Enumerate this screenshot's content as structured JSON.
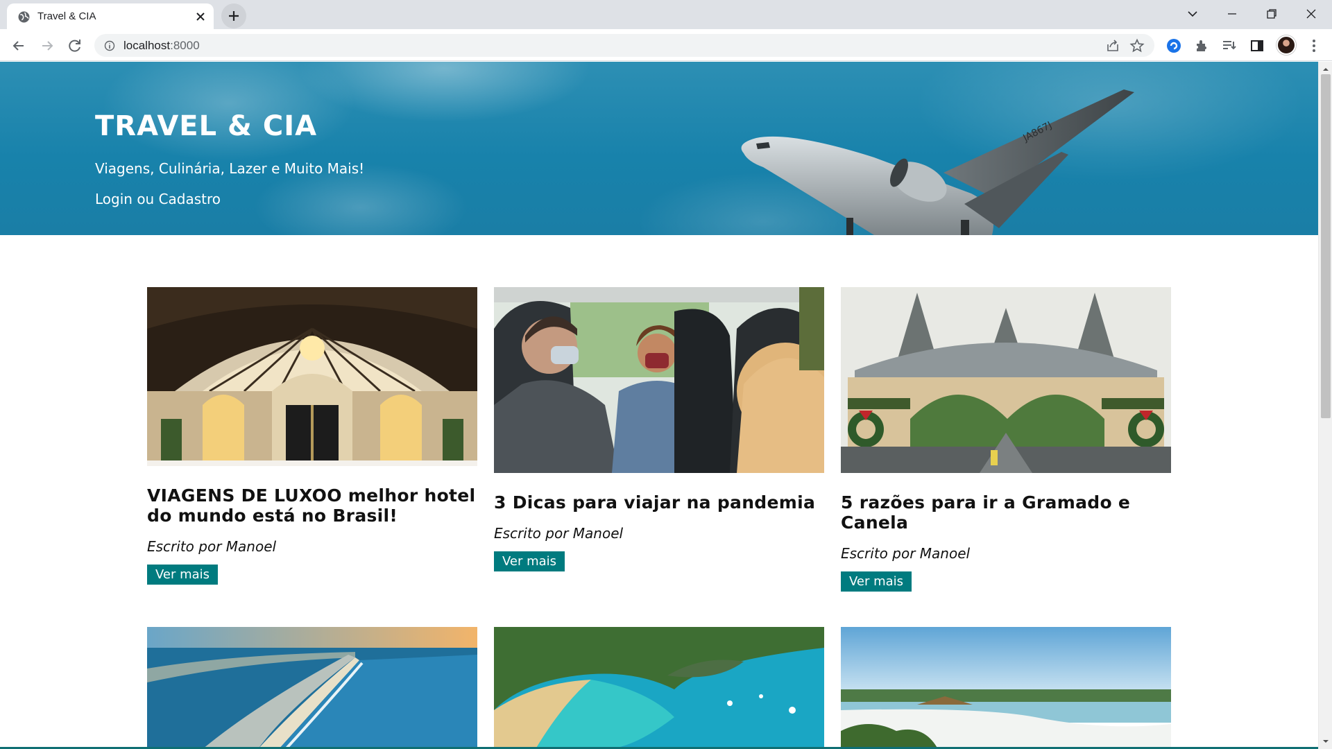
{
  "browser": {
    "tab_title": "Travel & CIA",
    "url_host": "localhost",
    "url_port": ":8000"
  },
  "hero": {
    "title": "TRAVEL & CIA",
    "subtitle": "Viagens, Culinária, Lazer e Muito Mais!",
    "login_link": "Login ou Cadastro",
    "plane_registration": "JA867J"
  },
  "posts": [
    {
      "title": "VIAGENS DE LUXOO melhor hotel do mundo está no Brasil!",
      "author": "Escrito por Manoel",
      "button": "Ver mais",
      "image": "luxury-hotel-entrance"
    },
    {
      "title": "3 Dicas para viajar na pandemia",
      "author": "Escrito por Manoel",
      "button": "Ver mais",
      "image": "masked-travelers-in-car"
    },
    {
      "title": "5 razões para ir a Gramado e Canela",
      "author": "Escrito por Manoel",
      "button": "Ver mais",
      "image": "gramado-portal"
    },
    {
      "image": "cancun-aerial-coast"
    },
    {
      "image": "fernando-de-noronha-bay"
    },
    {
      "image": "amazon-river-beach"
    }
  ],
  "colors": {
    "button": "#007b7f",
    "hero_sky": "#1882ab",
    "tabstrip": "#dee1e6"
  }
}
